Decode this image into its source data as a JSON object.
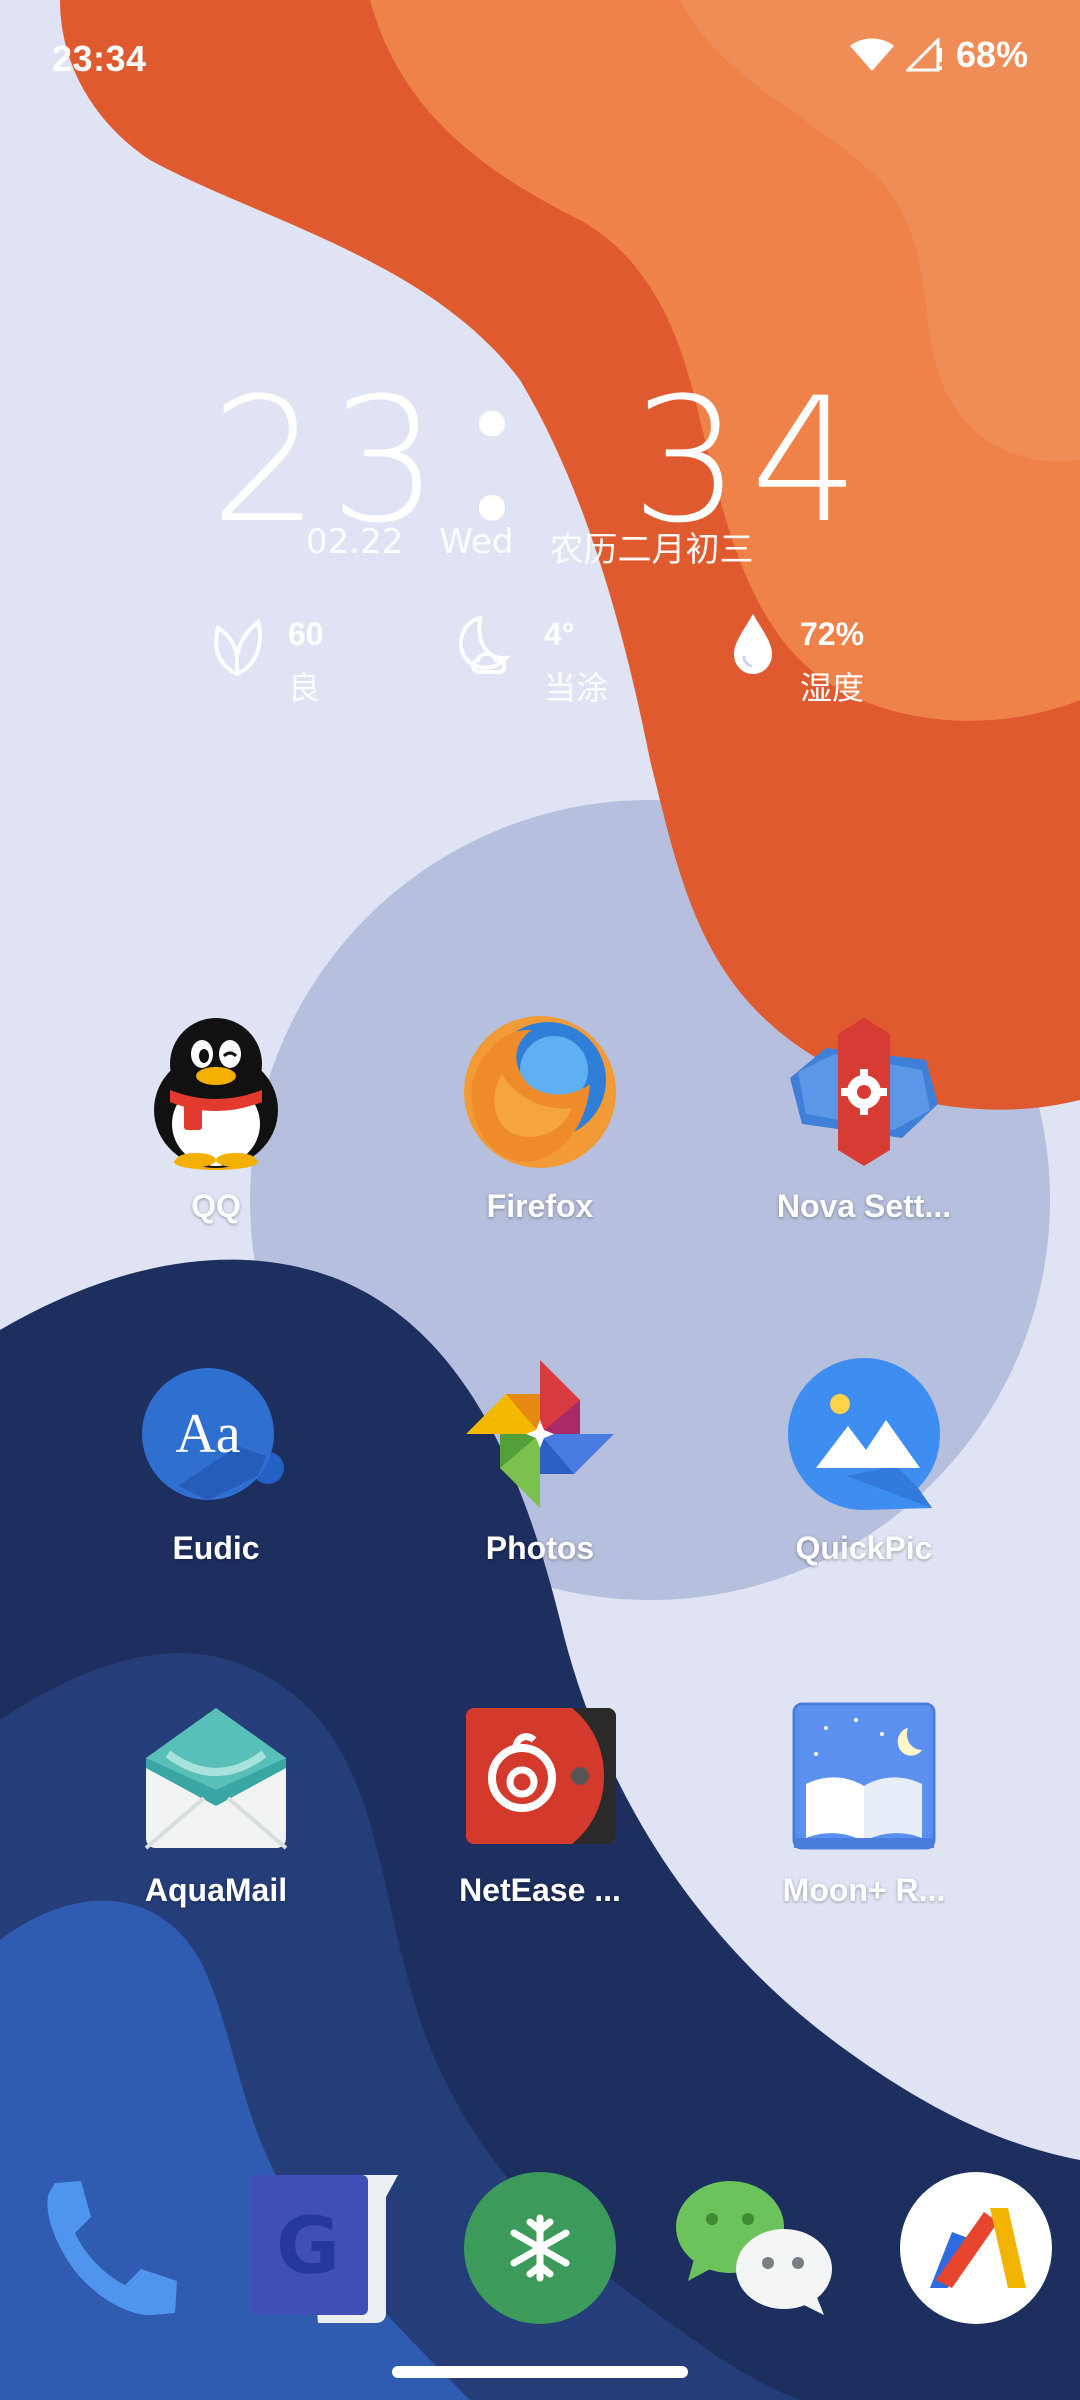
{
  "status_bar": {
    "time": "23:34",
    "battery": "68%",
    "icons": [
      "wifi-icon",
      "cell-signal-icon"
    ]
  },
  "clock_widget": {
    "time": "23：34",
    "date": "02.22",
    "weekday": "Wed",
    "lunar_date": "农历二月初三",
    "weather": [
      {
        "icon": "leaf-icon",
        "value": "60",
        "label": "良"
      },
      {
        "icon": "moon-cloud-icon",
        "value": "4°",
        "label": "当涂"
      },
      {
        "icon": "water-drop-icon",
        "value": "72%",
        "label": "湿度"
      }
    ]
  },
  "apps": [
    {
      "label": "QQ",
      "icon": "qq-penguin-icon"
    },
    {
      "label": "Firefox",
      "icon": "firefox-icon"
    },
    {
      "label": "Nova Sett...",
      "icon": "nova-settings-icon"
    },
    {
      "label": "Eudic",
      "icon": "eudic-icon"
    },
    {
      "label": "Photos",
      "icon": "photos-pinwheel-icon"
    },
    {
      "label": "QuickPic",
      "icon": "quickpic-icon"
    },
    {
      "label": "AquaMail",
      "icon": "aquamail-envelope-icon"
    },
    {
      "label": "NetEase ...",
      "icon": "netease-music-icon"
    },
    {
      "label": "Moon+ R...",
      "icon": "moon-reader-icon"
    }
  ],
  "dock": [
    {
      "icon": "phone-icon"
    },
    {
      "icon": "google-translate-icon"
    },
    {
      "icon": "snowflake-icon"
    },
    {
      "icon": "wechat-icon"
    },
    {
      "icon": "action-launcher-icon"
    }
  ],
  "colors": {
    "orange_dark": "#e05a2f",
    "orange_light": "#ef8249",
    "navy": "#1d2f5f",
    "blue": "#2f5bb0",
    "circle": "#b6bfdd",
    "background": "#dfe3f3"
  }
}
